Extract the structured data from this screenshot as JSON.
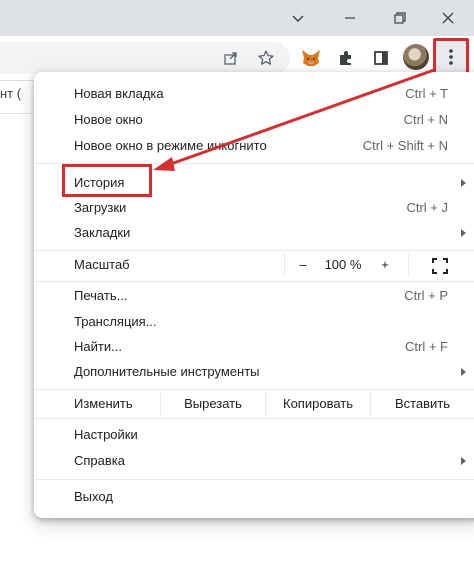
{
  "window": {
    "controls": [
      "chevron-down-icon",
      "minimize-icon",
      "restore-icon",
      "close-icon"
    ]
  },
  "toolbar": {
    "icons": [
      "share-icon",
      "star-icon",
      "metamask-fox-icon",
      "extensions-puzzle-icon",
      "side-panel-icon",
      "avatar",
      "more-vert-icon"
    ]
  },
  "page": {
    "left_text": "нт (",
    "accent": "#d32f2f"
  },
  "menu": {
    "new_tab": {
      "label": "Новая вкладка",
      "shortcut": "Ctrl + T"
    },
    "new_window": {
      "label": "Новое окно",
      "shortcut": "Ctrl + N"
    },
    "incognito": {
      "label": "Новое окно в режиме инкогнито",
      "shortcut": "Ctrl + Shift + N"
    },
    "history": {
      "label": "История"
    },
    "downloads": {
      "label": "Загрузки",
      "shortcut": "Ctrl + J"
    },
    "bookmarks": {
      "label": "Закладки"
    },
    "zoom": {
      "label": "Масштаб",
      "minus": "–",
      "value": "100 %",
      "plus": "+"
    },
    "print": {
      "label": "Печать...",
      "shortcut": "Ctrl + P"
    },
    "cast": {
      "label": "Трансляция..."
    },
    "find": {
      "label": "Найти...",
      "shortcut": "Ctrl + F"
    },
    "more_tools": {
      "label": "Дополнительные инструменты"
    },
    "edit": {
      "label": "Изменить",
      "cut": "Вырезать",
      "copy": "Копировать",
      "paste": "Вставить"
    },
    "settings": {
      "label": "Настройки"
    },
    "help": {
      "label": "Справка"
    },
    "exit": {
      "label": "Выход"
    }
  }
}
